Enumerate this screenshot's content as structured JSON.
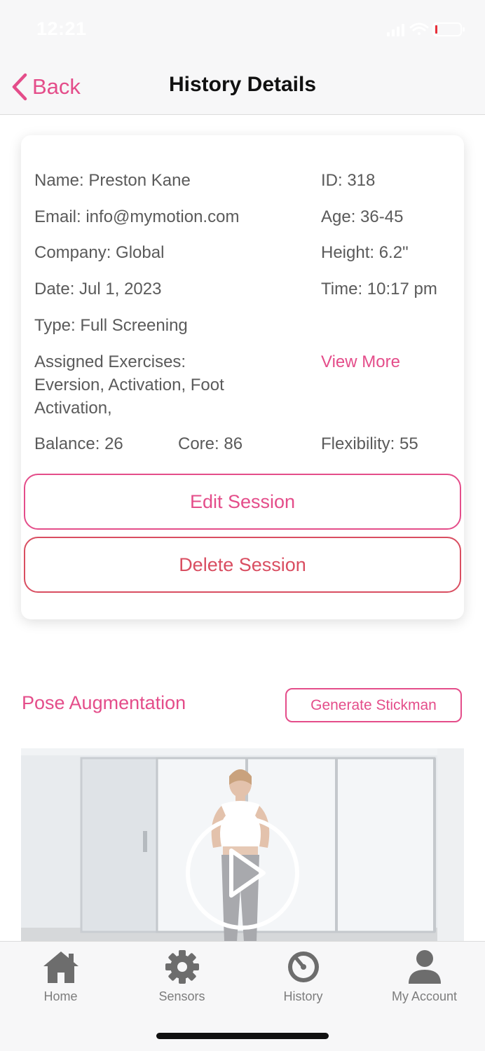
{
  "status_bar": {
    "time": "12:21"
  },
  "nav": {
    "back_label": "Back",
    "title": "History Details"
  },
  "details": {
    "name": "Name: Preston Kane",
    "id": "ID: 318",
    "email": "Email: info@mymotion.com",
    "age": "Age: 36-45",
    "company": "Company: Global",
    "height": "Height: 6.2\"",
    "date": "Date: Jul 1, 2023",
    "time": "Time: 10:17 pm",
    "type": "Type: Full Screening",
    "assigned_label": "Assigned Exercises:",
    "assigned_line1": "Eversion, Activation, Foot",
    "assigned_line2": "Activation,",
    "view_more": "View More",
    "balance": "Balance: 26",
    "core": "Core: 86",
    "flexibility": "Flexibility: 55"
  },
  "actions": {
    "edit": "Edit Session",
    "delete": "Delete Session"
  },
  "pose": {
    "title": "Pose Augmentation",
    "generate": "Generate Stickman"
  },
  "tabs": [
    {
      "label": "Home",
      "icon": "home-icon"
    },
    {
      "label": "Sensors",
      "icon": "gear-icon"
    },
    {
      "label": "History",
      "icon": "history-icon"
    },
    {
      "label": "My Account",
      "icon": "user-icon"
    }
  ],
  "colors": {
    "accent": "#e44d8a",
    "danger": "#d94e61"
  }
}
